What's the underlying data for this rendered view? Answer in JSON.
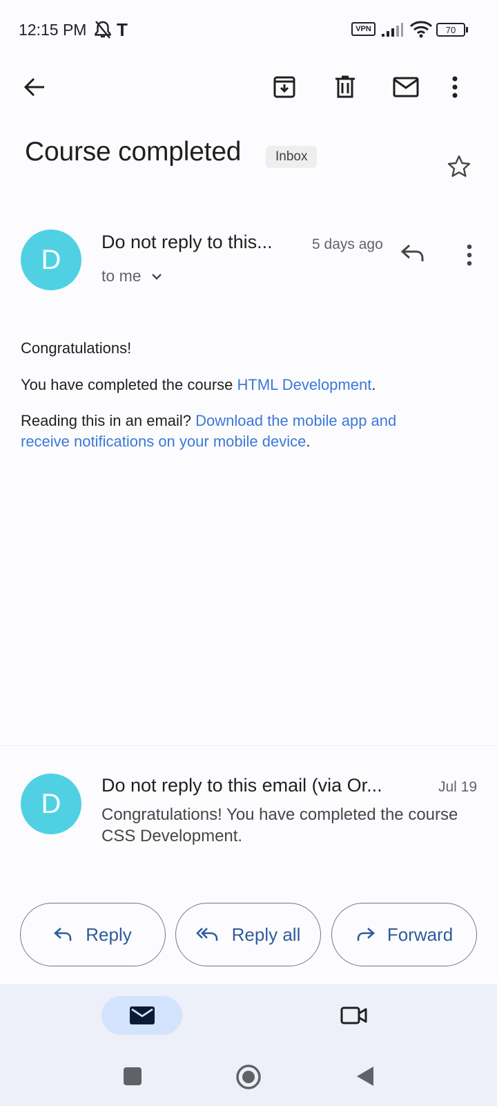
{
  "status_bar": {
    "time": "12:15 PM",
    "carrier_glyph": "T",
    "vpn_label": "VPN",
    "battery": "70"
  },
  "toolbar": {
    "icons": [
      "back-arrow-icon",
      "archive-icon",
      "delete-icon",
      "mark-unread-icon",
      "more-vert-icon"
    ]
  },
  "email": {
    "subject": "Course completed",
    "label": "Inbox",
    "star_icon": "star-outline-icon"
  },
  "message_open": {
    "avatar_letter": "D",
    "sender": "Do not reply to this...",
    "time": "5 days ago",
    "recipient": "to me",
    "body": {
      "line1": "Congratulations!",
      "line2_prefix": "You have completed the course ",
      "line2_link": "HTML Development",
      "line2_suffix": ".",
      "line3_prefix": "Reading this in an email? ",
      "line3_link_a": "Download the mobile app and",
      "line3_link_b": "receive notifications on your mobile device",
      "line3_suffix": "."
    }
  },
  "message_collapsed": {
    "avatar_letter": "D",
    "sender": "Do not reply to this email  (via Or...",
    "date": "Jul 19",
    "snippet": "Congratulations! You have completed the course CSS Development."
  },
  "actions": {
    "reply": "Reply",
    "reply_all": "Reply all",
    "forward": "Forward"
  },
  "bottom_nav": {
    "items": [
      "mail-icon",
      "video-camera-icon"
    ],
    "selected": "mail-icon"
  },
  "system_nav": {
    "items": [
      "recents-square-icon",
      "home-circle-icon",
      "back-triangle-icon"
    ]
  },
  "colors": {
    "avatar": "#4fd1e3",
    "link": "#3b78d6",
    "action_text": "#2f5b9a",
    "nav_selected": "#d3e3fd",
    "nav_bg": "#edf0f8"
  }
}
